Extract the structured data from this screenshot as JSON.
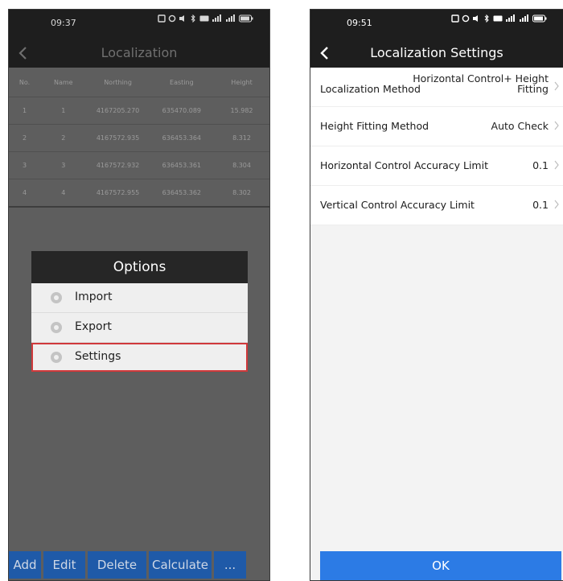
{
  "left": {
    "status": {
      "time": "09:37"
    },
    "title": "Localization",
    "table": {
      "headers": [
        "No.",
        "Name",
        "Northing",
        "Easting",
        "Height"
      ],
      "rows": [
        [
          "1",
          "1",
          "4167205.270",
          "635470.089",
          "15.982"
        ],
        [
          "2",
          "2",
          "4167572.935",
          "636453.364",
          "8.312"
        ],
        [
          "3",
          "3",
          "4167572.932",
          "636453.361",
          "8.304"
        ],
        [
          "4",
          "4",
          "4167572.955",
          "636453.362",
          "8.302"
        ]
      ]
    },
    "dialog": {
      "title": "Options",
      "options": [
        "Import",
        "Export",
        "Settings"
      ],
      "highlight_color": "#d0393b"
    },
    "bottom_buttons": [
      "Add",
      "Edit",
      "Delete",
      "Calculate",
      "..."
    ]
  },
  "right": {
    "status": {
      "time": "09:51"
    },
    "title": "Localization Settings",
    "rows": [
      {
        "label": "Localization Method",
        "value_line1": "Horizontal Control+ Height",
        "value_line2": "Fitting"
      },
      {
        "label": "Height Fitting Method",
        "value": "Auto Check"
      },
      {
        "label": "Horizontal Control Accuracy Limit",
        "value": "0.1"
      },
      {
        "label": "Vertical Control Accuracy Limit",
        "value": "0.1"
      }
    ],
    "ok_label": "OK",
    "accent": "#2c7be5"
  }
}
